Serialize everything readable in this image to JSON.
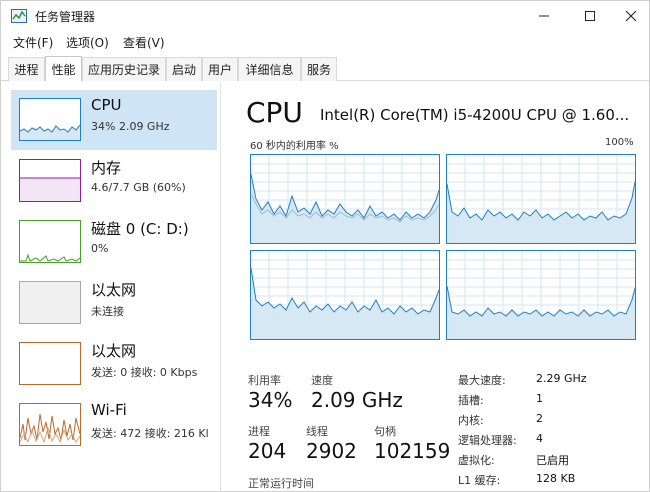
{
  "window": {
    "title": "任务管理器",
    "min_icon": "minimize-icon",
    "max_icon": "maximize-icon",
    "close_icon": "close-icon"
  },
  "menu": [
    "文件(F)",
    "选项(O)",
    "查看(V)"
  ],
  "tabs": [
    {
      "label": "进程",
      "active": false
    },
    {
      "label": "性能",
      "active": true
    },
    {
      "label": "应用历史记录",
      "active": false
    },
    {
      "label": "启动",
      "active": false
    },
    {
      "label": "用户",
      "active": false
    },
    {
      "label": "详细信息",
      "active": false
    },
    {
      "label": "服务",
      "active": false
    }
  ],
  "sidebar": {
    "items": [
      {
        "title": "CPU",
        "subtitle": "34% 2.09 GHz",
        "color": "#1f7fc1"
      },
      {
        "title": "内存",
        "subtitle": "4.6/7.7 GB (60%)",
        "color": "#8b1fa8"
      },
      {
        "title": "磁盘 0 (C: D:)",
        "subtitle": "0%",
        "color": "#4aa02c"
      },
      {
        "title": "以太网",
        "subtitle": "未连接",
        "color": "#a7a7a7"
      },
      {
        "title": "以太网",
        "subtitle": "发送: 0 接收: 0 Kbps",
        "color": "#b86a2e"
      },
      {
        "title": "Wi-Fi",
        "subtitle": "发送: 472 接收: 216 Kl",
        "color": "#b86a2e"
      }
    ]
  },
  "main": {
    "title": "CPU",
    "model": "Intel(R) Core(TM) i5-4200U CPU @ 1.60...",
    "graph_caption": "60 秒内的利用率 %",
    "graph_max": "100%",
    "stats": {
      "utilization_label": "利用率",
      "utilization_value": "34%",
      "speed_label": "速度",
      "speed_value": "2.09 GHz",
      "processes_label": "进程",
      "processes_value": "204",
      "threads_label": "线程",
      "threads_value": "2902",
      "handles_label": "句柄",
      "handles_value": "102159",
      "uptime_label": "正常运行时间"
    },
    "details": [
      {
        "label": "最大速度:",
        "value": "2.29 GHz"
      },
      {
        "label": "插槽:",
        "value": "1"
      },
      {
        "label": "内核:",
        "value": "2"
      },
      {
        "label": "逻辑处理器:",
        "value": "4"
      },
      {
        "label": "虚拟化:",
        "value": "已启用"
      },
      {
        "label": "L1 缓存:",
        "value": "128 KB"
      }
    ]
  },
  "colors": {
    "cpu_line": "#1f7fc1",
    "cpu_fill": "#d7e8f5",
    "selected_bg": "#cfe5f5",
    "grid": "#d6e6f3"
  }
}
